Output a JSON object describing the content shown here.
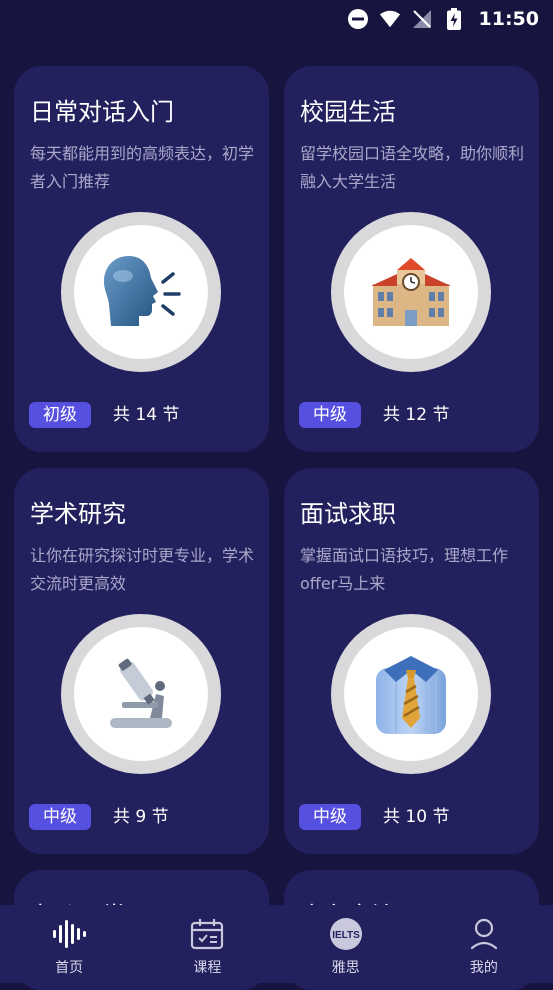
{
  "status_bar": {
    "time": "11:50"
  },
  "cards": [
    {
      "title": "日常对话入门",
      "desc": "每天都能用到的高频表达，初学者入门推荐",
      "level": "初级",
      "count": "共 14 节",
      "icon": "speaking-head-icon"
    },
    {
      "title": "校园生活",
      "desc": "留学校园口语全攻略，助你顺利融入大学生活",
      "level": "中级",
      "count": "共 12 节",
      "icon": "school-building-icon"
    },
    {
      "title": "学术研究",
      "desc": "让你在研究探讨时更专业，学术交流时更高效",
      "level": "中级",
      "count": "共 9 节",
      "icon": "microscope-icon"
    },
    {
      "title": "面试求职",
      "desc": "掌握面试口语技巧，理想工作offer马上来",
      "level": "中级",
      "count": "共 10 节",
      "icon": "shirt-tie-icon"
    },
    {
      "title": "办公日常",
      "icon": ""
    },
    {
      "title": "商务交流",
      "icon": ""
    }
  ],
  "nav": [
    {
      "label": "首页",
      "icon": "soundwave-icon"
    },
    {
      "label": "课程",
      "icon": "calendar-check-icon"
    },
    {
      "label": "雅思",
      "icon": "ielts-badge-icon",
      "badge_text": "IELTS"
    },
    {
      "label": "我的",
      "icon": "profile-icon"
    }
  ],
  "colors": {
    "background": "#17153f",
    "card": "#23205e",
    "badge": "#5650e0",
    "muted_text": "#a9a8c9"
  }
}
